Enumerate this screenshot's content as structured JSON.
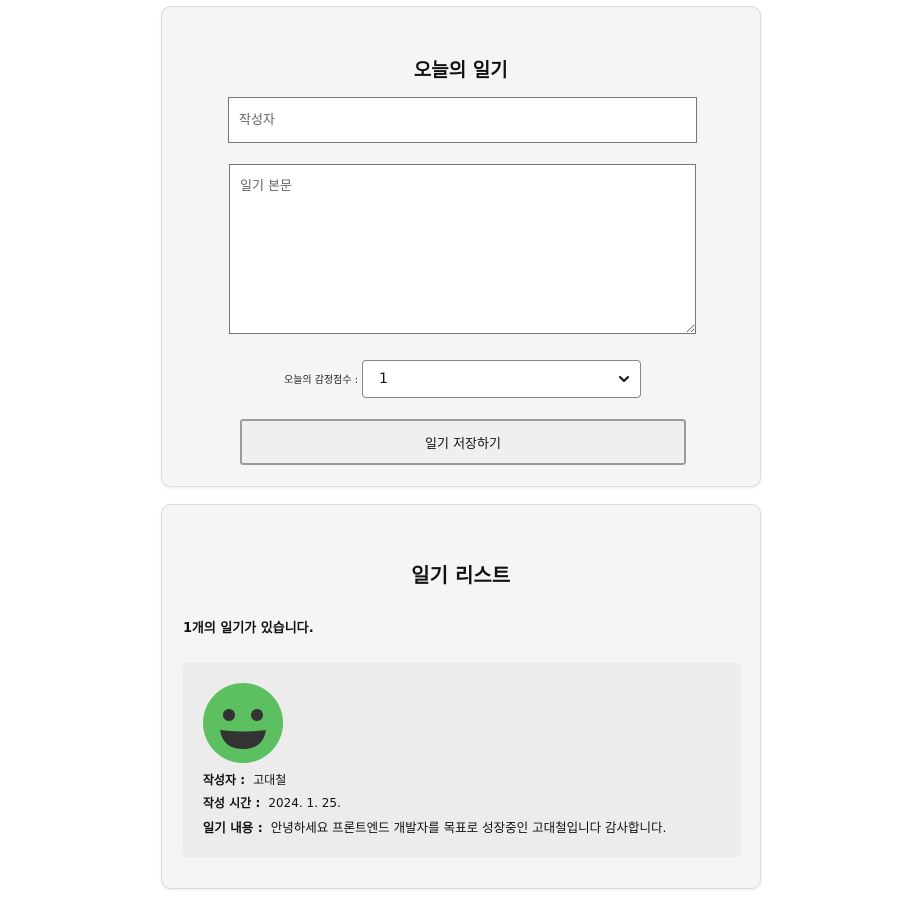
{
  "editor": {
    "title": "오늘의 일기",
    "author_placeholder": "작성자",
    "author_value": "",
    "content_placeholder": "일기 본문",
    "content_value": "",
    "emotion_label": "오늘의 감정점수 :",
    "emotion_selected": "1",
    "save_label": "일기 저장하기"
  },
  "list": {
    "title": "일기 리스트",
    "count_text": "1개의 일기가 있습니다.",
    "items": [
      {
        "emotion_icon": "smiley-face-icon",
        "emotion_color": "#5cbf60",
        "author_label": "작성자 :",
        "author": "고대철",
        "time_label": "작성 시간 :",
        "time": "2024. 1. 25.",
        "content_label": "일기 내용 :",
        "content": "안녕하세요 프론트엔드 개발자를 목표로 성장중인 고대철입니다 감사합니다."
      }
    ]
  }
}
